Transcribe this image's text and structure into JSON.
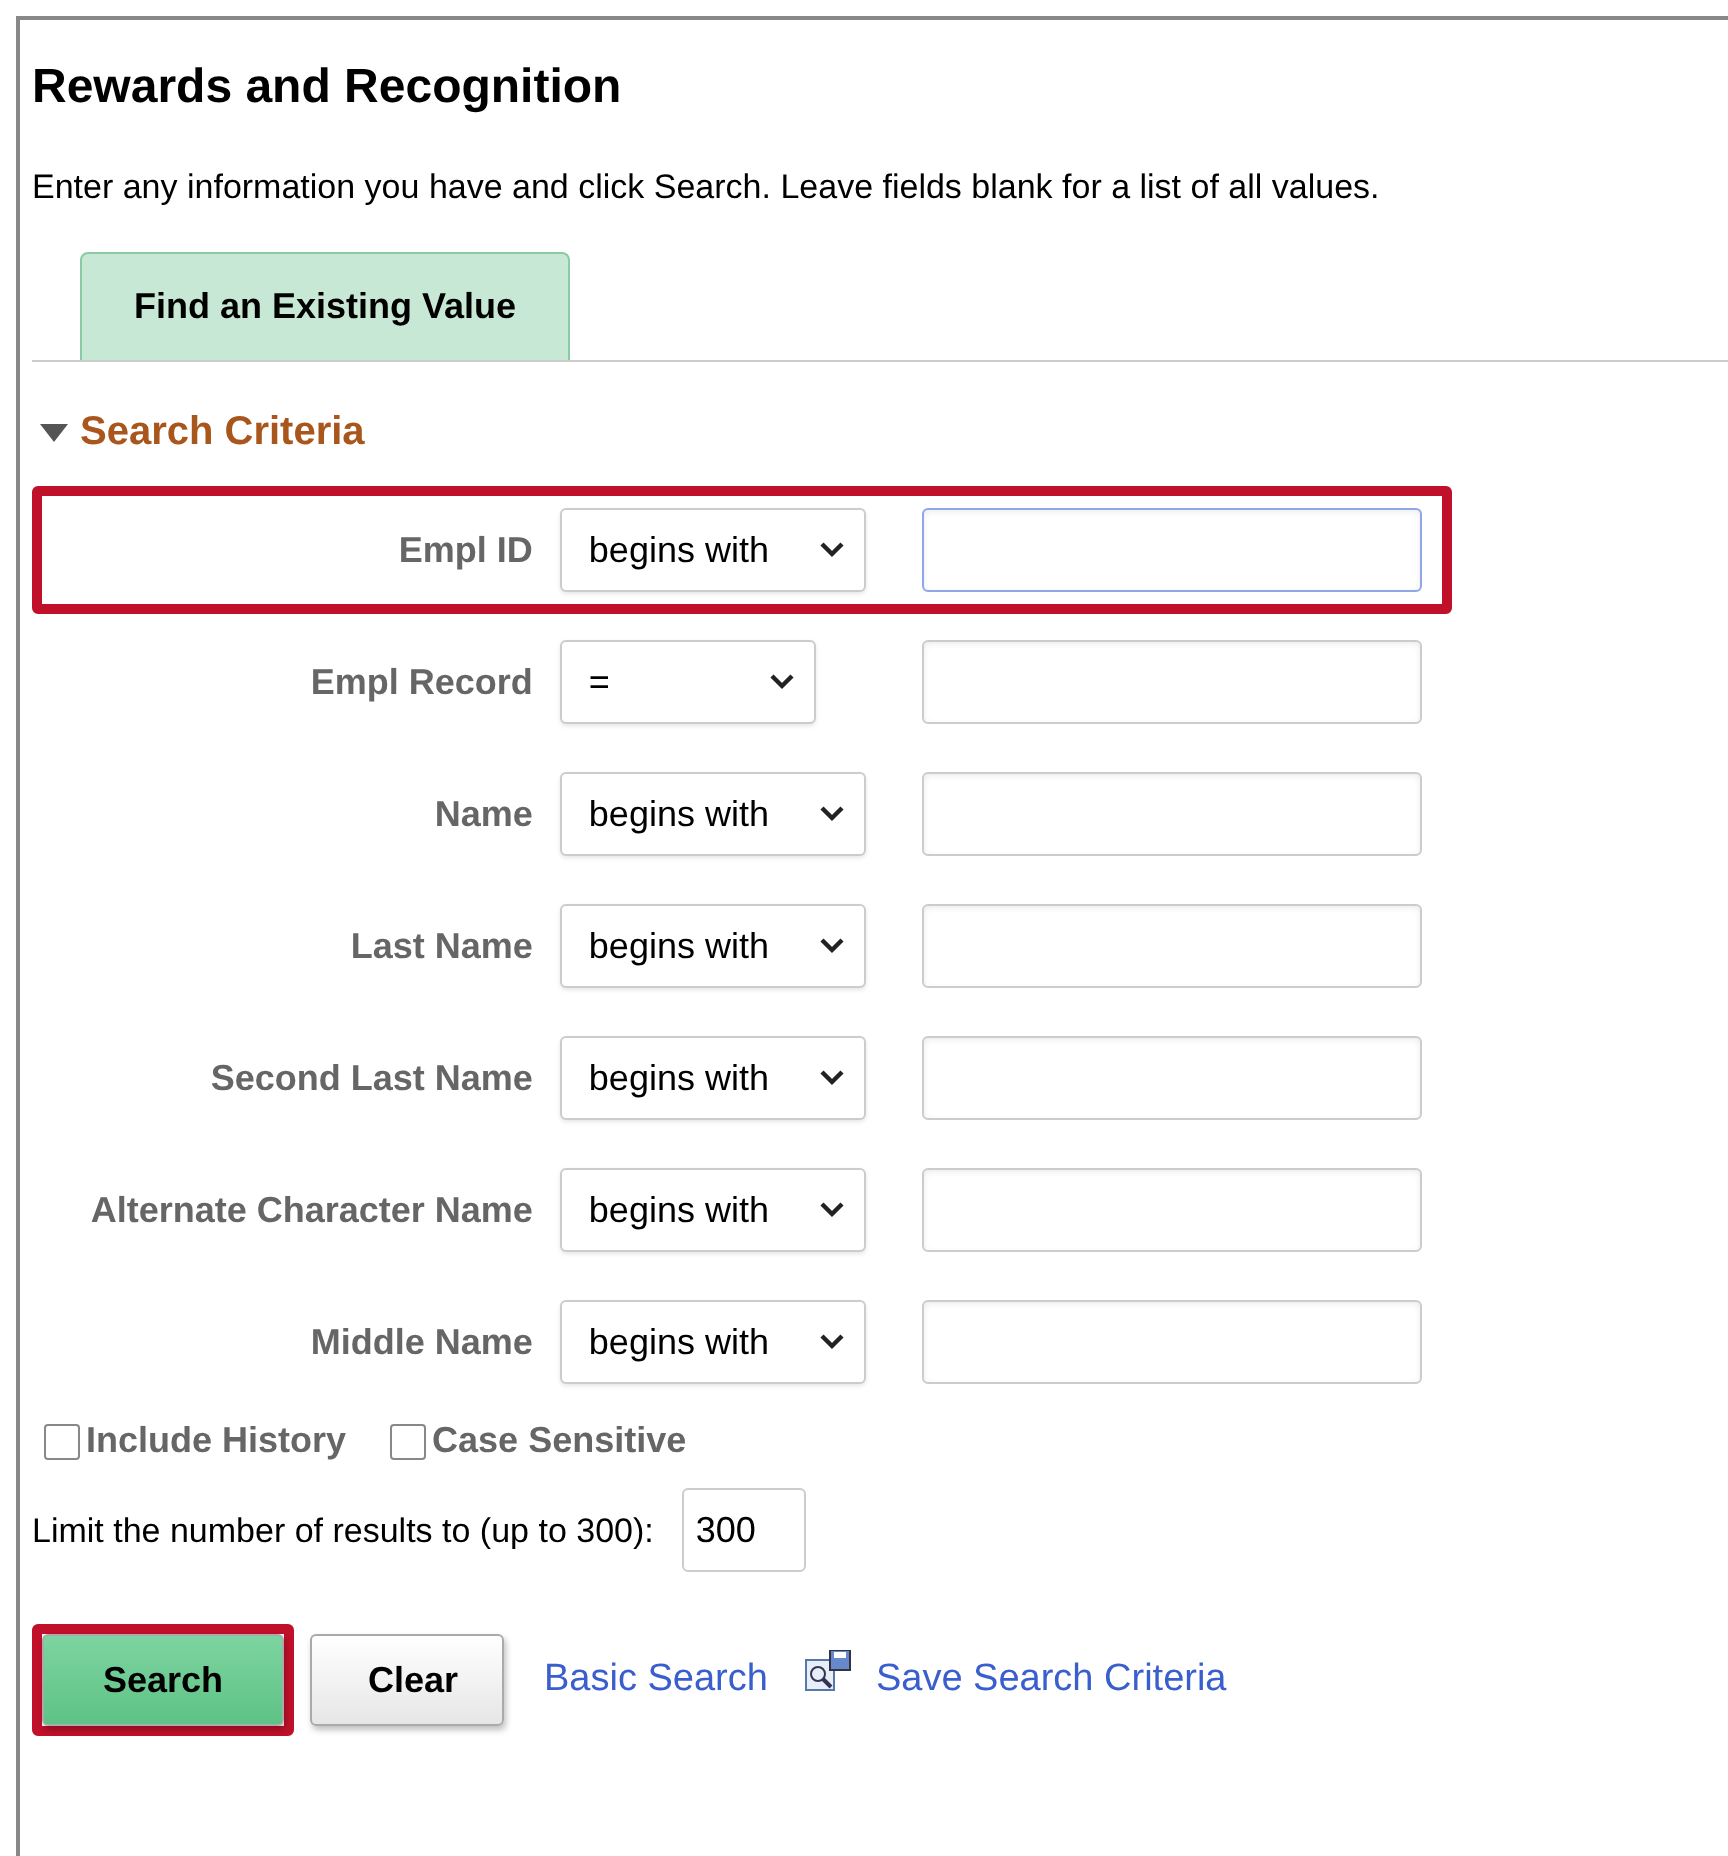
{
  "title": "Rewards and Recognition",
  "instructions": "Enter any information you have and click Search. Leave fields blank for a list of all values.",
  "tabs": [
    {
      "label": "Find an Existing Value",
      "selected": true
    }
  ],
  "section": {
    "title": "Search Criteria",
    "expanded": true
  },
  "criteria": [
    {
      "label": "Empl ID",
      "operator": "begins with",
      "focused": true,
      "highlighted": true
    },
    {
      "label": "Empl Record",
      "operator": "=",
      "focused": false,
      "highlighted": false
    },
    {
      "label": "Name",
      "operator": "begins with",
      "focused": false,
      "highlighted": false
    },
    {
      "label": "Last Name",
      "operator": "begins with",
      "focused": false,
      "highlighted": false
    },
    {
      "label": "Second Last Name",
      "operator": "begins with",
      "focused": false,
      "highlighted": false
    },
    {
      "label": "Alternate Character Name",
      "operator": "begins with",
      "focused": false,
      "highlighted": false
    },
    {
      "label": "Middle Name",
      "operator": "begins with",
      "focused": false,
      "highlighted": false
    }
  ],
  "options": [
    {
      "label": "Include History",
      "checked": false
    },
    {
      "label": "Case Sensitive",
      "checked": false
    }
  ],
  "limit": {
    "label": "Limit the number of results to (up to 300):",
    "value": "300"
  },
  "buttons": [
    {
      "label": "Search",
      "kind": "primary",
      "highlighted": true
    },
    {
      "label": "Clear",
      "kind": "secondary",
      "highlighted": false
    }
  ],
  "links": [
    {
      "label": "Basic Search",
      "icon": false
    },
    {
      "label": "Save Search Criteria",
      "icon": true
    }
  ]
}
